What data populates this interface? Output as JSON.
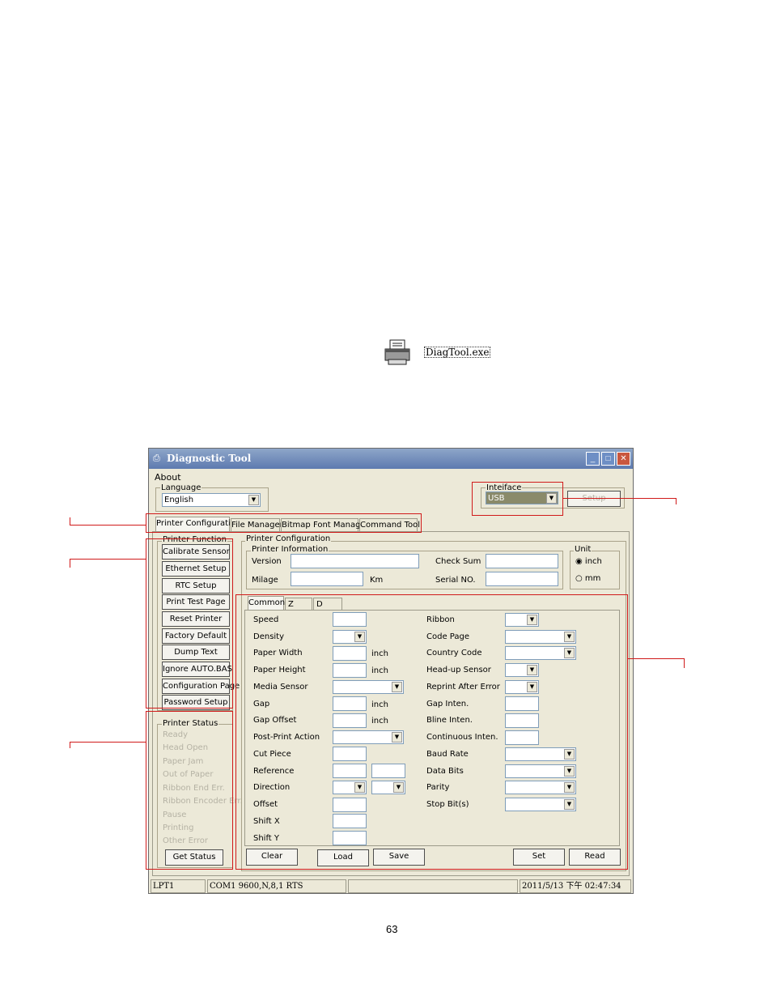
{
  "file_icon": {
    "label": "DiagTool.exe",
    "icon": "printer-icon"
  },
  "window": {
    "title": "Diagnostic Tool",
    "menu_about": "About",
    "language": {
      "label": "Language",
      "value": "English"
    },
    "interface": {
      "label": "Inteiface",
      "value": "USB",
      "setup": "Setup"
    },
    "main_tabs": [
      "Printer Configuration",
      "File Manager",
      "Bitmap Font Manager",
      "Command Tool"
    ],
    "printer_function": {
      "label": "Printer Function",
      "buttons": [
        "Calibrate Sensor",
        "Ethernet Setup",
        "RTC Setup",
        "Print Test Page",
        "Reset Printer",
        "Factory Default",
        "Dump Text",
        "Ignore AUTO.BAS",
        "Configuration Page",
        "Password Setup"
      ]
    },
    "printer_status": {
      "label": "Printer Status",
      "items": [
        "Ready",
        "Head Open",
        "Paper Jam",
        "Out of Paper",
        "Ribbon End Err.",
        "Ribbon Encoder Err.",
        "Pause",
        "Printing",
        "Other Error"
      ],
      "get_status": "Get Status"
    },
    "printer_config": {
      "label": "Printer Configuration",
      "info_label": "Printer Information",
      "version": "Version",
      "checksum": "Check Sum",
      "milage": "Milage",
      "km": "Km",
      "serial": "Serial NO.",
      "unit": {
        "label": "Unit",
        "inch": "inch",
        "mm": "mm"
      }
    },
    "sub_tabs": [
      "Common",
      "Z",
      "D"
    ],
    "left_fields": [
      "Speed",
      "Density",
      "Paper Width",
      "Paper Height",
      "Media Sensor",
      "Gap",
      "Gap Offset",
      "Post-Print Action",
      "Cut Piece",
      "Reference",
      "Direction",
      "Offset",
      "Shift X",
      "Shift Y"
    ],
    "inch": "inch",
    "right_fields": [
      "Ribbon",
      "Code Page",
      "Country Code",
      "Head-up Sensor",
      "Reprint After Error",
      "Gap Inten.",
      "Bline Inten.",
      "Continuous Inten.",
      "Baud Rate",
      "Data Bits",
      "Parity",
      "Stop Bit(s)"
    ],
    "bottom_buttons": {
      "clear": "Clear",
      "load": "Load",
      "save": "Save",
      "set": "Set",
      "read": "Read"
    },
    "statusbar": {
      "port": "LPT1",
      "com": "COM1 9600,N,8,1 RTS",
      "middle": "",
      "datetime": "2011/5/13 下午 02:47:34"
    }
  },
  "page_number": "63",
  "colors": {
    "annotation": "#d01a1a",
    "window_bg": "#ece9d8",
    "titlebar": "#6f8bbd"
  }
}
